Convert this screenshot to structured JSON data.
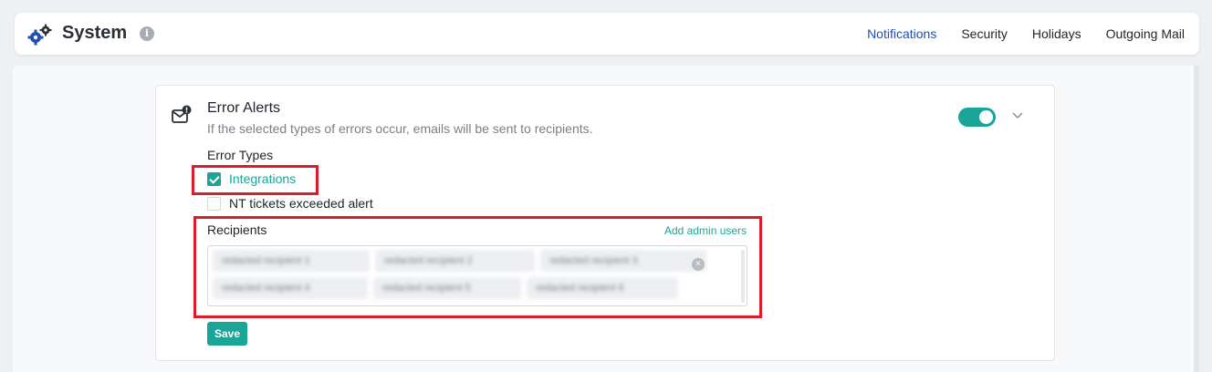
{
  "header": {
    "title": "System",
    "info_glyph": "i",
    "nav": [
      {
        "label": "Notifications",
        "active": true
      },
      {
        "label": "Security",
        "active": false
      },
      {
        "label": "Holidays",
        "active": false
      },
      {
        "label": "Outgoing Mail",
        "active": false
      }
    ]
  },
  "card": {
    "title": "Error Alerts",
    "description": "If the selected types of errors occur, emails will be sent to recipients.",
    "toggle_on": true,
    "error_types_label": "Error Types",
    "error_types": [
      {
        "label": "Integrations",
        "checked": true
      },
      {
        "label": "NT tickets exceeded alert",
        "checked": false
      }
    ],
    "recipients_label": "Recipients",
    "add_admin_label": "Add admin users",
    "recipients": [
      "redacted recipient 1",
      "redacted recipient 2",
      "redacted recipient 3",
      "redacted recipient 4",
      "redacted recipient 5",
      "redacted recipient 6"
    ],
    "remove_glyph": "×",
    "save_label": "Save"
  },
  "colors": {
    "accent": "#1aa597",
    "nav_active": "#1f4eb5",
    "highlight": "#d81e2a"
  },
  "icons": [
    "gears-icon",
    "info-icon",
    "mail-alert-icon",
    "chevron-down-icon",
    "check-icon",
    "remove-chip-icon"
  ]
}
